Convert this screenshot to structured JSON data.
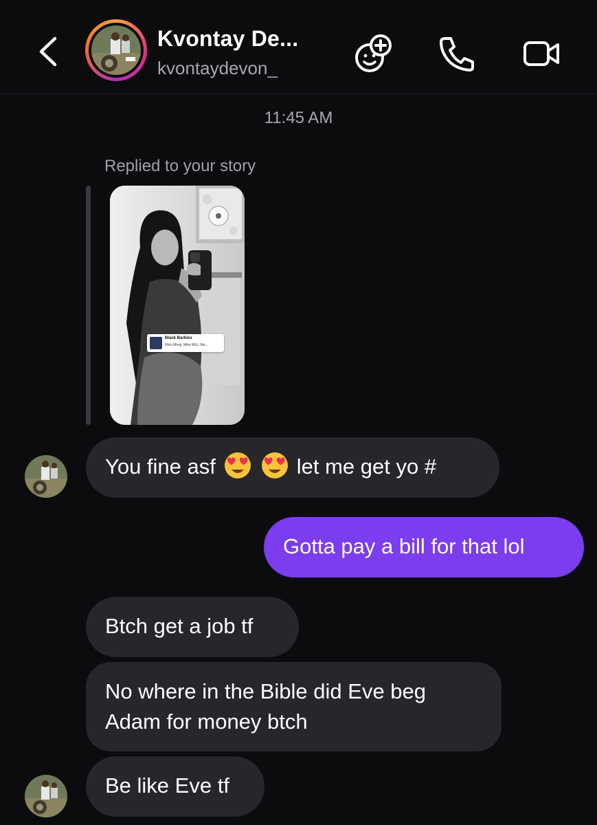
{
  "header": {
    "contact_name": "Kvontay De...",
    "contact_handle": "kvontaydevon_",
    "back_icon": "chevron-left-icon",
    "icons": [
      "add-effect-icon",
      "phone-icon",
      "video-call-icon"
    ]
  },
  "thread": {
    "timestamp": "11:45 AM",
    "reply_label": "Replied to your story",
    "story_sticker": {
      "song": "Black Barbies",
      "artist": "Nicki Minaj, Mike WiLL Ma..."
    },
    "messages": [
      {
        "from": "them",
        "text_before": "You fine asf",
        "emojis": [
          "heart-eyes-emoji",
          "heart-eyes-emoji"
        ],
        "text_after": "let me get yo #"
      },
      {
        "from": "me",
        "text": "Gotta pay a bill for that lol"
      },
      {
        "from": "them",
        "text": "Btch get a job tf"
      },
      {
        "from": "them",
        "text": "No where in the Bible did Eve beg Adam for money btch"
      },
      {
        "from": "them",
        "text": "Be like Eve tf"
      }
    ]
  },
  "colors": {
    "background": "#0c0c0f",
    "received_bubble": "#26262b",
    "sent_bubble": "#7c3dee",
    "secondary_text": "#a8a8ad"
  }
}
